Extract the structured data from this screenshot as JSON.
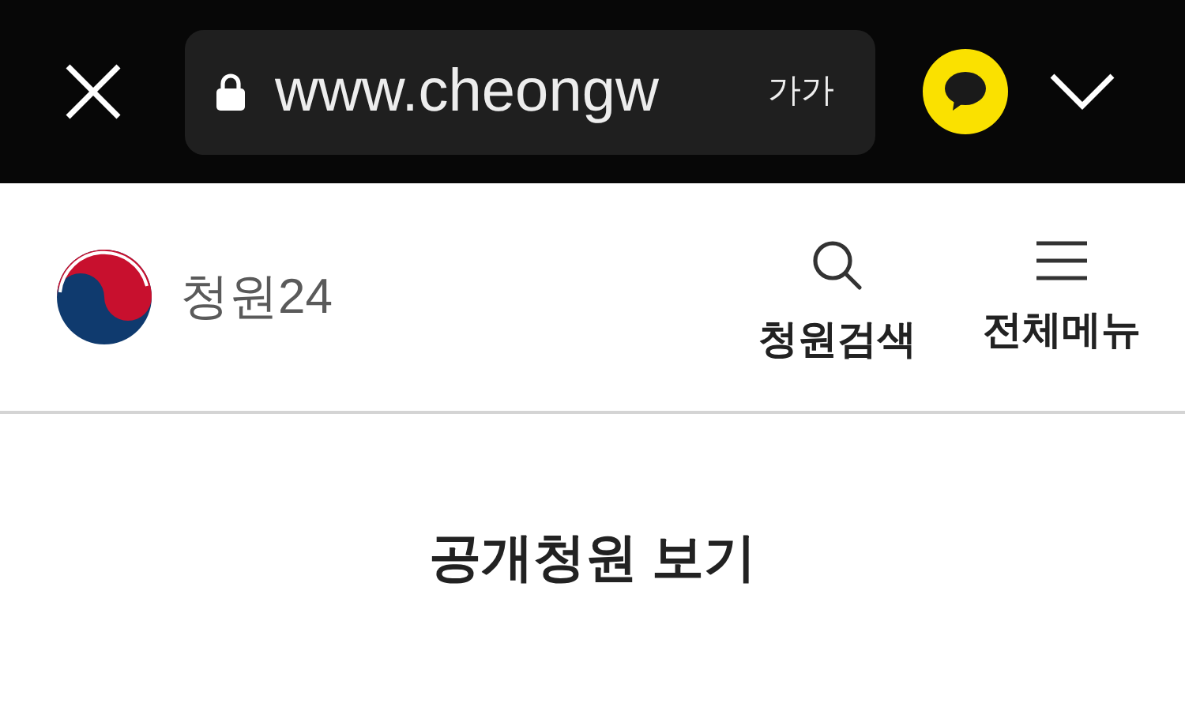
{
  "browser_bar": {
    "url": "www.cheongw",
    "text_size_button": "가가"
  },
  "header": {
    "logo_text": "청원24",
    "actions": [
      {
        "kind": "search",
        "label": "청원검색"
      },
      {
        "kind": "menu",
        "label": "전체메뉴"
      }
    ]
  },
  "page_title": "공개청원 보기"
}
